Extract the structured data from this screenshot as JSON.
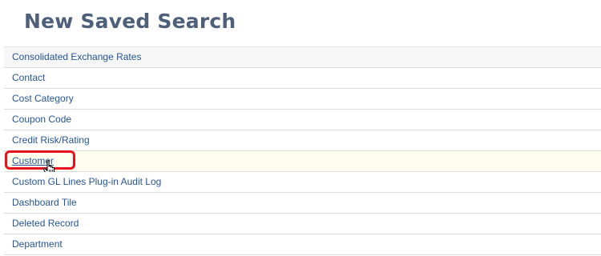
{
  "page": {
    "title": "New Saved Search"
  },
  "records": [
    {
      "label": "Consolidated Exchange Rates"
    },
    {
      "label": "Contact"
    },
    {
      "label": "Cost Category"
    },
    {
      "label": "Coupon Code"
    },
    {
      "label": "Credit Risk/Rating"
    },
    {
      "label": "Customer",
      "state": "hovered"
    },
    {
      "label": "Custom GL Lines Plug-in Audit Log"
    },
    {
      "label": "Dashboard Tile"
    },
    {
      "label": "Deleted Record"
    },
    {
      "label": "Department"
    }
  ],
  "colors": {
    "title": "#4d5f79",
    "link": "#255599",
    "highlight_box": "#e8121c"
  },
  "icons": {
    "cursor": "hand-pointer-icon"
  }
}
